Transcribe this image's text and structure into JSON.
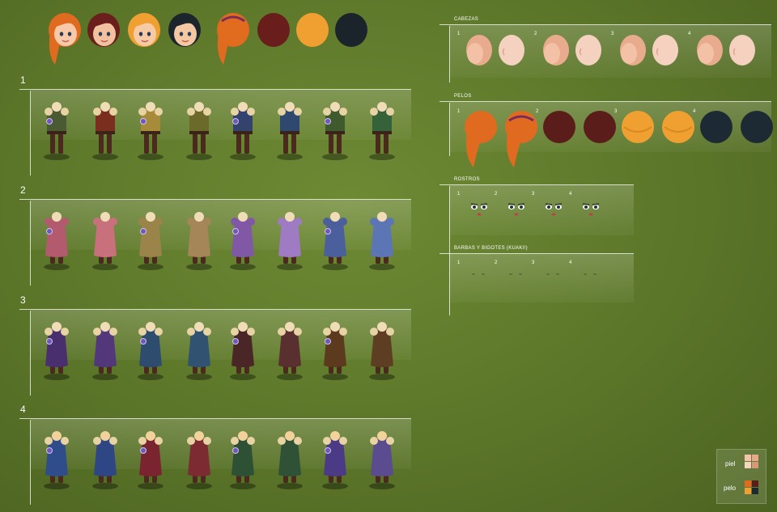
{
  "rows": [
    {
      "label": "1",
      "colors": [
        "#4a5a33",
        "#7a2e1e",
        "#a58b3a",
        "#6c6a2a",
        "#33436e",
        "#2f4870",
        "#3f5b2d",
        "#356238"
      ]
    },
    {
      "label": "2",
      "colors": [
        "#b35a6e",
        "#c9707d",
        "#9b8449",
        "#a48659",
        "#8058a6",
        "#9f7bc4",
        "#4b5f9c",
        "#5c76b5"
      ]
    },
    {
      "label": "3",
      "colors": [
        "#4a2f6e",
        "#52377a",
        "#2e4d6e",
        "#315270",
        "#4a2626",
        "#5a2f2f",
        "#5b3a1e",
        "#5e3e22"
      ]
    },
    {
      "label": "4",
      "colors": [
        "#2e4d8a",
        "#2f4685",
        "#7a2430",
        "#7d2b32",
        "#2e5136",
        "#2f5136",
        "#4b3a86",
        "#5a4c8f"
      ]
    }
  ],
  "panels": {
    "cabezas": {
      "title": "CABEZAS",
      "nums": [
        "1",
        "2",
        "3",
        "4"
      ]
    },
    "pelos": {
      "title": "PELOS",
      "nums": [
        "1",
        "2",
        "3",
        "4"
      ],
      "hair_colors": [
        "#e06b20",
        "#e06b20",
        "#5a1d1a",
        "#5a1d1a",
        "#f0a030",
        "#f0a030",
        "#1e2a33",
        "#1e2a33"
      ]
    },
    "rostros": {
      "title": "ROSTROS",
      "nums": [
        "1",
        "2",
        "3",
        "4"
      ]
    },
    "barbas": {
      "title": "BARBAS Y BIGOTES (KUAKI!)",
      "nums": [
        "1",
        "2",
        "3",
        "4"
      ]
    }
  },
  "top_heads": [
    {
      "hair": "#e06b20",
      "skin": "#f7c9a8"
    },
    {
      "hair": "#6a1f1c",
      "skin": "#f2c2a0"
    },
    {
      "hair": "#f0a030",
      "skin": "#f7caa6"
    },
    {
      "hair": "#1c252c",
      "skin": "#f5c8a4"
    },
    {
      "hair": "#e06b20",
      "skin": "#f7c9a8"
    },
    {
      "hair": "#6a1f1c",
      "skin": "#f2c2a0"
    },
    {
      "hair": "#f0a030",
      "skin": "#f7caa6"
    },
    {
      "hair": "#1c252c",
      "skin": "#f5c8a4"
    }
  ],
  "legend": {
    "piel_label": "piel",
    "pelo_label": "pelo",
    "piel_colors": [
      "#f3c4a8",
      "#e9a88a",
      "#f7d6c0",
      "#d9967a"
    ],
    "pelo_colors": [
      "#e06b20",
      "#5a1d1a",
      "#f0a030",
      "#1e2a33"
    ]
  }
}
